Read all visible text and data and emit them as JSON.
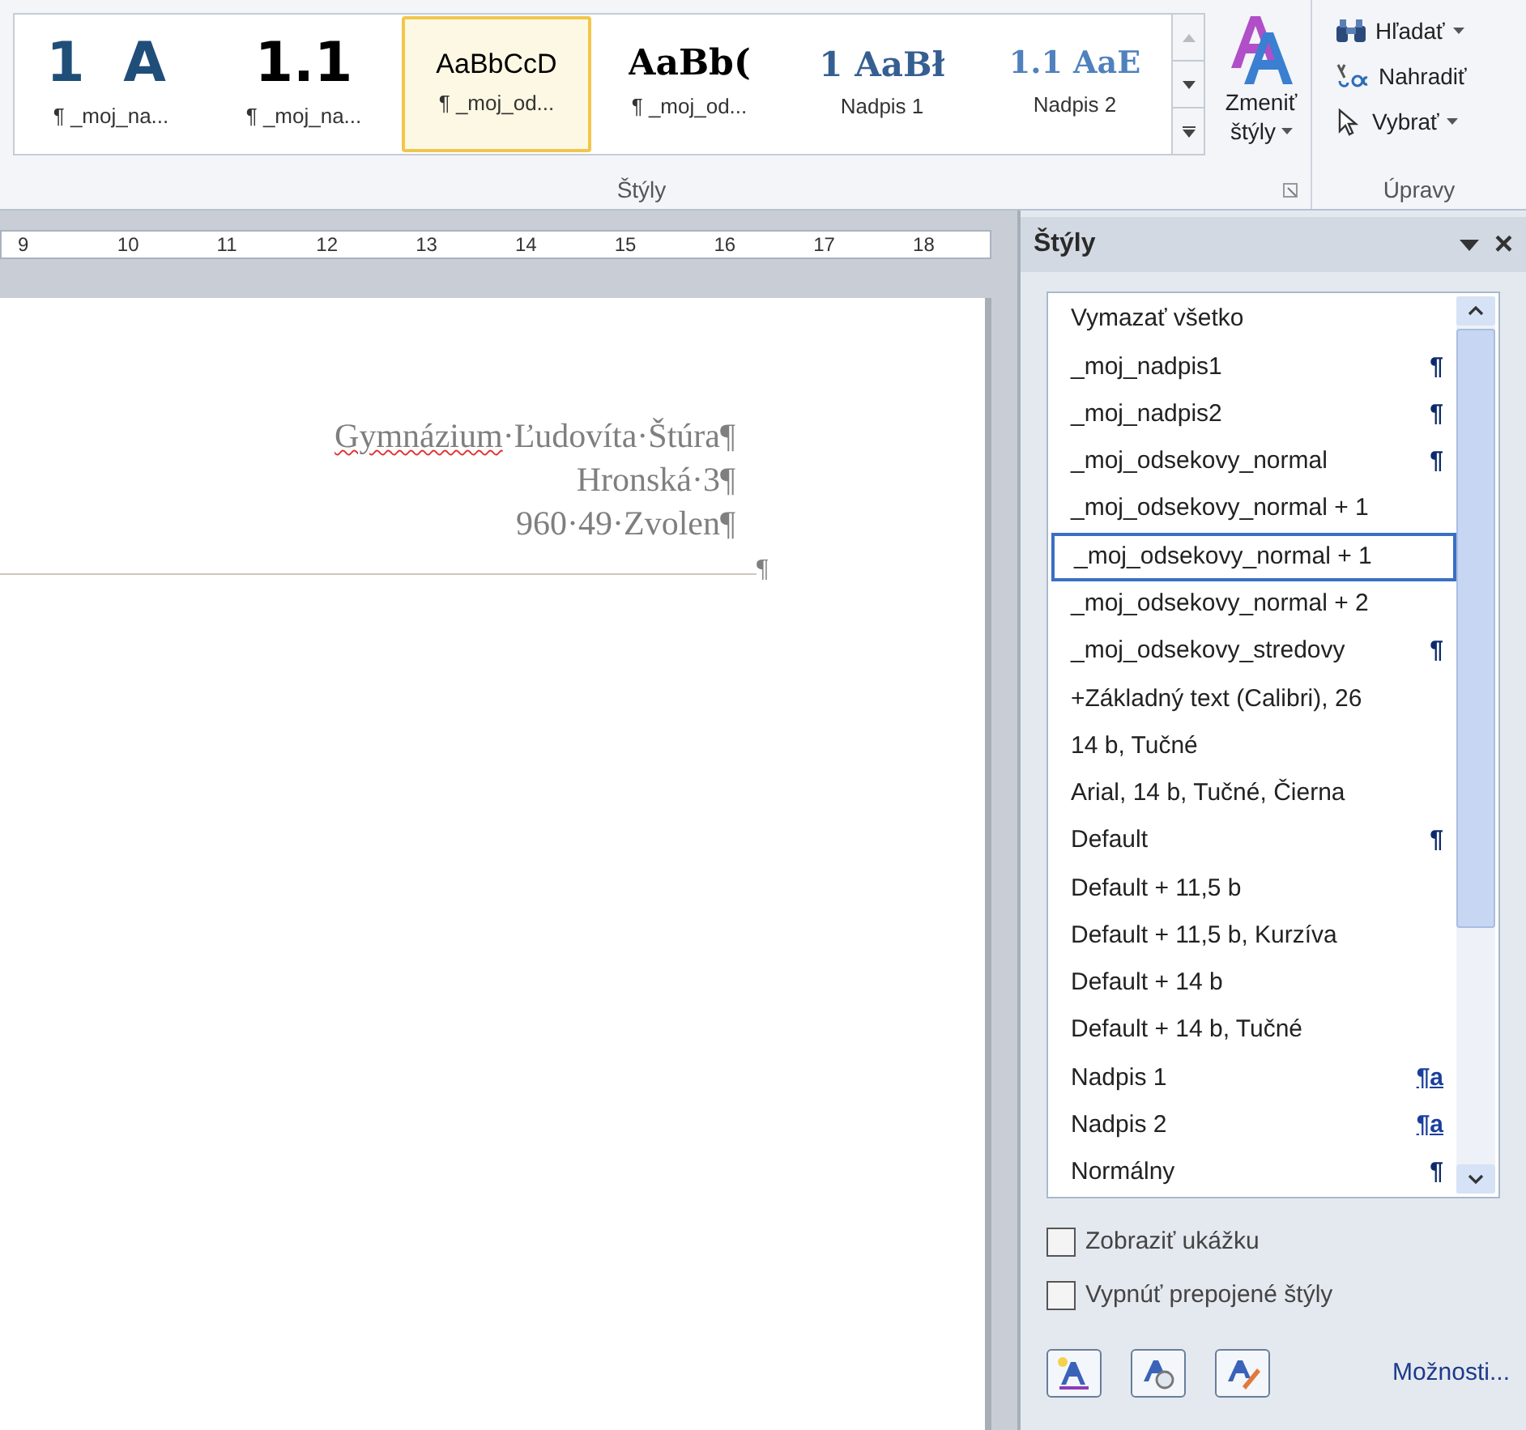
{
  "ribbon": {
    "gallery": [
      {
        "preview": "1 A",
        "label": "¶ _moj_na...",
        "kind": "heading_sans",
        "selected": false
      },
      {
        "preview": "1.1",
        "label": "¶ _moj_na...",
        "kind": "heading_black",
        "selected": false
      },
      {
        "preview": "AaBbCcD",
        "label": "¶ _moj_od...",
        "kind": "normal",
        "selected": true
      },
      {
        "preview": "AaBb(",
        "label": "¶ _moj_od...",
        "kind": "serif_bold",
        "selected": false
      },
      {
        "preview": "1 AaBł",
        "label": "Nadpis 1",
        "kind": "serif_blue",
        "selected": false
      },
      {
        "preview": "1.1 AaE",
        "label": "Nadpis 2",
        "kind": "serif_blue_light",
        "selected": false
      }
    ],
    "change_styles": {
      "line1": "Zmeniť",
      "line2": "štýly"
    },
    "styles_group_label": "Štýly",
    "editing": [
      {
        "label": "Hľadať",
        "kind": "find",
        "dropdown": true
      },
      {
        "label": "Nahradiť",
        "kind": "replace",
        "dropdown": false
      },
      {
        "label": "Vybrať",
        "kind": "select",
        "dropdown": true
      }
    ],
    "editing_group_label": "Úpravy"
  },
  "ruler": {
    "numbers": [
      "9",
      "10",
      "11",
      "12",
      "13",
      "14",
      "15",
      "16",
      "17",
      "18"
    ]
  },
  "document": {
    "lines": [
      [
        {
          "text": "Gymnázium",
          "misspelled": true
        },
        {
          "text": "·Ľudovíta·Štúra¶",
          "misspelled": false
        }
      ],
      [
        {
          "text": "Hronská·3¶",
          "misspelled": false
        }
      ],
      [
        {
          "text": "960·49·Zvolen¶",
          "misspelled": false
        }
      ]
    ],
    "end_mark": "¶"
  },
  "styles_pane": {
    "title": "Štýly",
    "close": "×",
    "items": [
      {
        "name": "Vymazať všetko",
        "selected": false
      },
      {
        "name": "_moj_nadpis1",
        "selected": false,
        "marker": {
          "kind": "paragraph",
          "text": "¶"
        }
      },
      {
        "name": "_moj_nadpis2",
        "selected": false,
        "marker": {
          "kind": "paragraph",
          "text": "¶"
        }
      },
      {
        "name": "_moj_odsekovy_normal",
        "selected": false,
        "marker": {
          "kind": "paragraph",
          "text": "¶"
        }
      },
      {
        "name": "_moj_odsekovy_normal + 1",
        "selected": false
      },
      {
        "name": "_moj_odsekovy_normal + 1",
        "selected": true
      },
      {
        "name": "_moj_odsekovy_normal + 2",
        "selected": false
      },
      {
        "name": "_moj_odsekovy_stredovy",
        "selected": false,
        "marker": {
          "kind": "paragraph",
          "text": "¶"
        }
      },
      {
        "name": "+Základný text (Calibri), 26",
        "selected": false
      },
      {
        "name": "14 b, Tučné",
        "selected": false
      },
      {
        "name": "Arial, 14 b, Tučné, Čierna",
        "selected": false
      },
      {
        "name": "Default",
        "selected": false,
        "marker": {
          "kind": "paragraph",
          "text": "¶"
        }
      },
      {
        "name": "Default + 11,5 b",
        "selected": false
      },
      {
        "name": "Default + 11,5 b, Kurzíva",
        "selected": false
      },
      {
        "name": "Default + 14 b",
        "selected": false
      },
      {
        "name": "Default + 14 b, Tučné",
        "selected": false
      },
      {
        "name": "Nadpis 1",
        "selected": false,
        "marker": {
          "kind": "linked",
          "text": "¶a"
        }
      },
      {
        "name": "Nadpis 2",
        "selected": false,
        "marker": {
          "kind": "linked",
          "text": "¶a"
        }
      },
      {
        "name": "Normálny",
        "selected": false,
        "marker": {
          "kind": "paragraph",
          "text": "¶"
        }
      }
    ],
    "options": [
      {
        "label": "Zobraziť ukážku",
        "checked": false
      },
      {
        "label": "Vypnúť prepojené štýly",
        "checked": false
      }
    ],
    "link": "Možnosti..."
  }
}
